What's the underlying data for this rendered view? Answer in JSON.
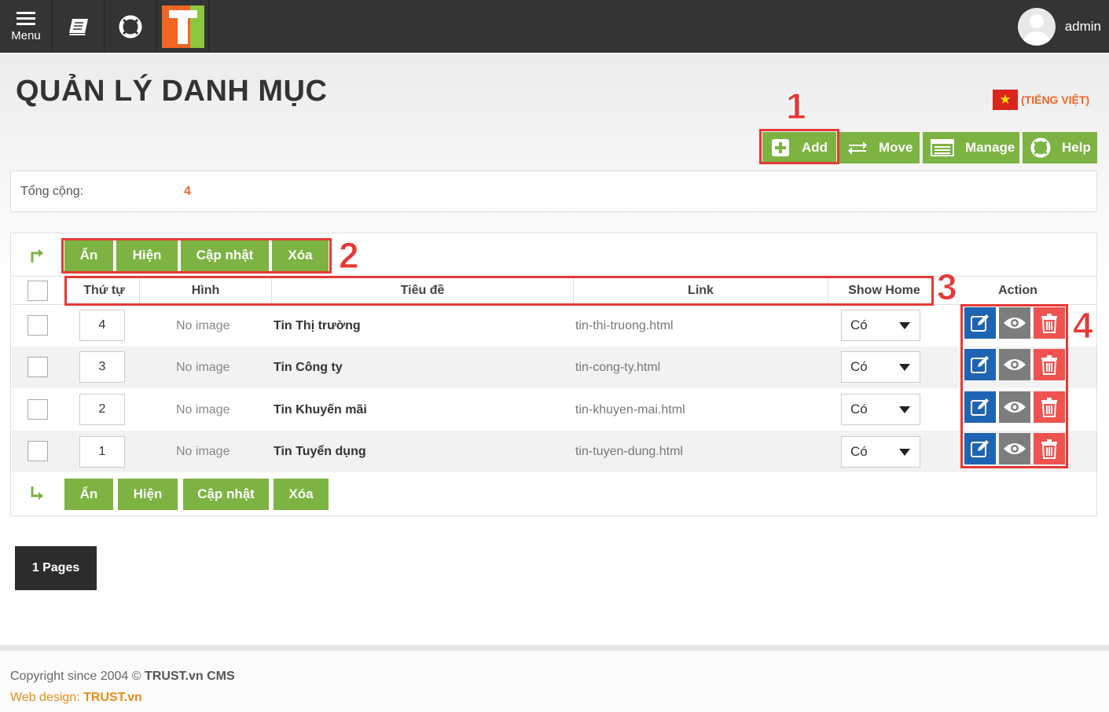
{
  "topbar": {
    "menu_label": "Menu",
    "user_name": "admin",
    "logo_letter": "T"
  },
  "page": {
    "title": "QUẢN LÝ DANH MỤC",
    "language": "(TIẾNG VIỆT)"
  },
  "toolbar": {
    "add_label": "Add",
    "move_label": "Move",
    "manage_label": "Manage",
    "help_label": "Help"
  },
  "summary": {
    "total_label": "Tổng cộng:",
    "total_value": "4"
  },
  "bulk_actions": {
    "hide": "Ẩn",
    "show": "Hiện",
    "update": "Cập nhật",
    "delete": "Xóa"
  },
  "table": {
    "columns": [
      "Thứ tự",
      "Hình",
      "Tiêu đề",
      "Link",
      "Show Home",
      "Action"
    ],
    "rows": [
      {
        "order": "4",
        "image": "No image",
        "title": "Tin Thị trường",
        "link": "tin-thi-truong.html",
        "show_home": "Có"
      },
      {
        "order": "3",
        "image": "No image",
        "title": "Tin Công ty",
        "link": "tin-cong-ty.html",
        "show_home": "Có"
      },
      {
        "order": "2",
        "image": "No image",
        "title": "Tin Khuyến mãi",
        "link": "tin-khuyen-mai.html",
        "show_home": "Có"
      },
      {
        "order": "1",
        "image": "No image",
        "title": "Tin Tuyển dụng",
        "link": "tin-tuyen-dung.html",
        "show_home": "Có"
      }
    ]
  },
  "pagination": {
    "label": "1 Pages"
  },
  "footer": {
    "copyright_prefix": "Copyright since 2004 ©",
    "copyright_brand": "TRUST.vn CMS",
    "webdesign_prefix": "Web design:",
    "webdesign_brand": "TRUST.vn"
  },
  "annotations": {
    "n1": "1",
    "n2": "2",
    "n3": "3",
    "n4": "4"
  },
  "colors": {
    "accent_green": "#7cb342",
    "accent_orange": "#f26522",
    "edit_blue": "#1f64b2",
    "delete_red": "#ef5350",
    "annotation_red": "#e53935"
  }
}
